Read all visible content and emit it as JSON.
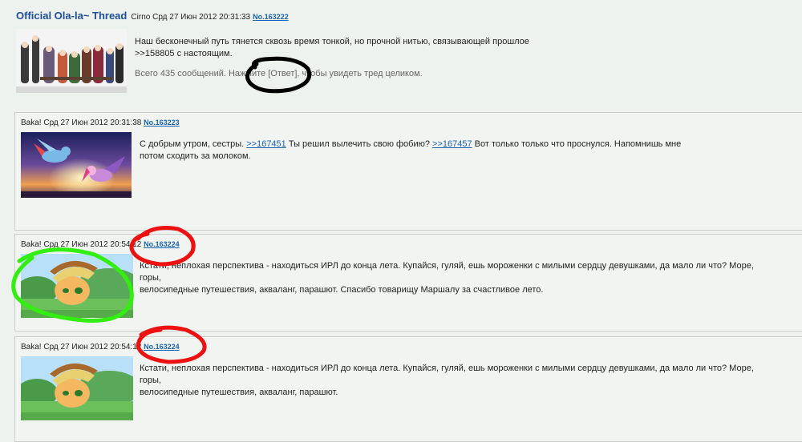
{
  "op": {
    "subject": "Official Ola-la~ Thread",
    "meta": "Cirno Срд 27 Июн 2012 20:31:33",
    "number": "No.163222",
    "message_line1": "Наш бесконечный путь тянется сквозь время тонкой, но прочной нитью, связывающей прошлое",
    "message_line2": ">>158805 с настоящим.",
    "omitted": "Всего 435 сообщений. Нажмите [Ответ], чтобы увидеть тред целиком."
  },
  "replies": [
    {
      "meta": "Baka! Срд 27 Июн 2012 20:31:38",
      "number": "No.163223",
      "text_a": "С добрым утром, сестры.",
      "ref1": ">>167451",
      "text_b": "Ты решил вылечить свою фобию?",
      "ref2": ">>167457",
      "text_c": "Вот только только что проснулся. Напомнишь мне",
      "text_d": "потом сходить за молоком."
    },
    {
      "meta": "Baka! Срд 27 Июн 2012 20:54:12",
      "number": "No.163224",
      "line1": "Кстати, неплохая перспектива - находиться ИРЛ до конца лета. Купайся, гуляй, ешь мороженки с милыми сердцу девушками, да мало ли что? Море, горы,",
      "line2": "велосипедные путешествия, акваланг, парашют. Спасибо товарищу Маршалу за счастливое лето."
    },
    {
      "meta": "Baka! Срд 27 Июн 2012 20:54:12",
      "number": "No.163224",
      "line1": "Кстати, неплохая перспектива - находиться ИРЛ до конца лета. Купайся, гуляй, ешь мороженки с милыми сердцу девушками, да мало ли что? Море, горы,",
      "line2": "велосипедные путешествия, акваланг, парашют."
    }
  ],
  "colors": {
    "link": "#1a62b0",
    "subject": "#1d4e9b",
    "annotation_red": "#ee1111",
    "annotation_green": "#33ee11",
    "annotation_black": "#000000"
  }
}
